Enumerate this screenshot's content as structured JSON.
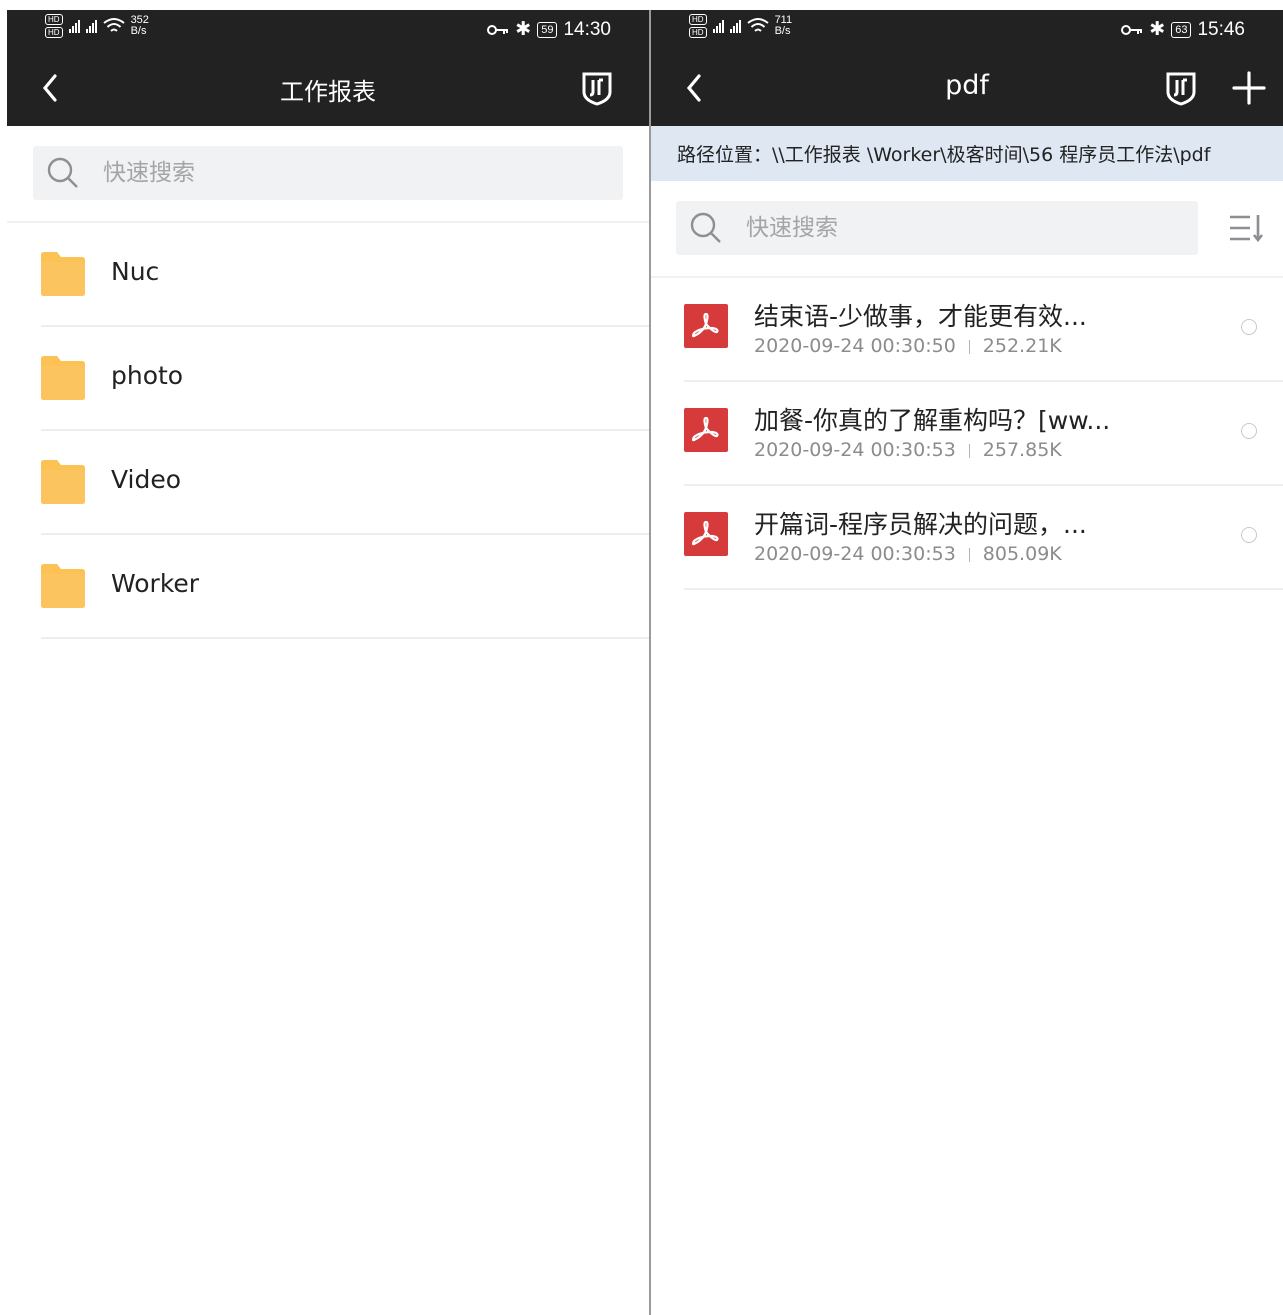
{
  "left": {
    "status": {
      "speed_value": "352",
      "speed_unit": "B/s",
      "battery": "59",
      "time": "14:30"
    },
    "header": {
      "title": "工作报表"
    },
    "search": {
      "placeholder": "快速搜索"
    },
    "folders": [
      {
        "name": "Nuc"
      },
      {
        "name": "photo"
      },
      {
        "name": "Video"
      },
      {
        "name": "Worker"
      }
    ]
  },
  "right": {
    "status": {
      "speed_value": "711",
      "speed_unit": "B/s",
      "battery": "63",
      "time": "15:46"
    },
    "header": {
      "title": "pdf"
    },
    "path": "路径位置：\\\\工作报表 \\Worker\\极客时间\\56 程序员工作法\\pdf",
    "search": {
      "placeholder": "快速搜索"
    },
    "files": [
      {
        "name": "结束语-少做事，才能更有效...",
        "date": "2020-09-24 00:30:50",
        "size": "252.21K"
      },
      {
        "name": "加餐-你真的了解重构吗？[ww...",
        "date": "2020-09-24 00:30:53",
        "size": "257.85K"
      },
      {
        "name": "开篇词-程序员解决的问题，...",
        "date": "2020-09-24 00:30:53",
        "size": "805.09K"
      }
    ]
  },
  "colors": {
    "header_bg": "#222222",
    "folder": "#fcc256",
    "pdf": "#d63a3a",
    "path_bg": "#dfe7f3",
    "search_bg": "#f1f2f4"
  },
  "icons": [
    "back-icon",
    "shield-icon",
    "plus-icon",
    "search-icon",
    "sort-icon",
    "folder-icon",
    "pdf-icon",
    "vpn-key-icon",
    "bluetooth-icon",
    "wifi-icon",
    "signal-icon",
    "radio-icon"
  ]
}
